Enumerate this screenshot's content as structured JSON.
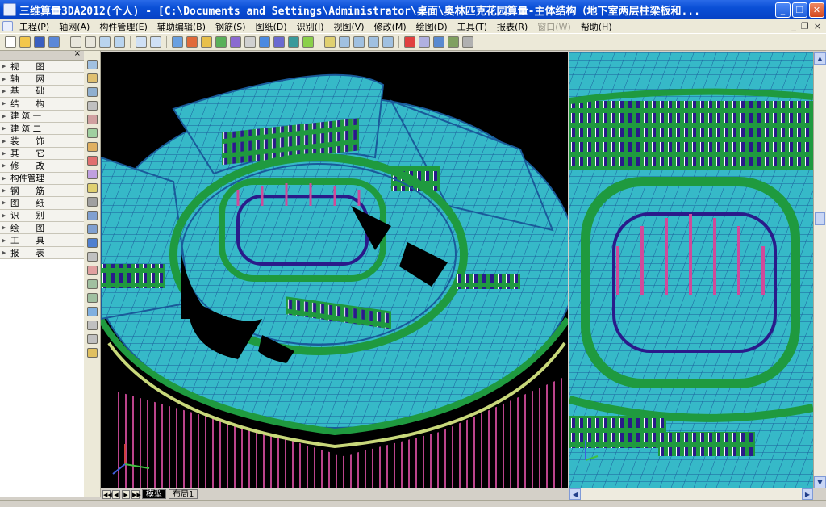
{
  "window": {
    "title": "三维算量3DA2012(个人) - [C:\\Documents and Settings\\Administrator\\桌面\\奥林匹克花园算量-主体结构（地下室两层柱梁板和...",
    "minimize_label": "_",
    "restore_label": "❐",
    "close_label": "✕"
  },
  "menu": {
    "items": [
      "工程(P)",
      "轴网(A)",
      "构件管理(E)",
      "辅助编辑(B)",
      "钢筋(S)",
      "图纸(D)",
      "识别(I)",
      "视图(V)",
      "修改(M)",
      "绘图(D)",
      "工具(T)",
      "报表(R)",
      "窗口(W)",
      "帮助(H)"
    ],
    "disabled_item": "窗口(W)",
    "right_controls": [
      "_",
      "❐",
      "×"
    ]
  },
  "panel": {
    "close_label": "×",
    "items": [
      "视　　图",
      "轴　　网",
      "基　　础",
      "结　　构",
      "建 筑 一",
      "建 筑 二",
      "装　　饰",
      "其　　它",
      "修　　改",
      "构件管理",
      "钢　　筋",
      "图　　纸",
      "识　　别",
      "绘　　图",
      "工　　具",
      "报　　表"
    ]
  },
  "tabs": {
    "nav": [
      "◀◀",
      "◀",
      "▶",
      "▶▶"
    ],
    "items": [
      "模型",
      "布局1"
    ]
  },
  "scroll": {
    "up": "▲",
    "down": "▼",
    "left": "◀",
    "right": "▶"
  },
  "colors": {
    "floor": "#36b9c8",
    "wall": "#1f9a3f",
    "column": "#d04a9a",
    "window": "#2a1a8a",
    "beam": "#1a5a9a"
  }
}
